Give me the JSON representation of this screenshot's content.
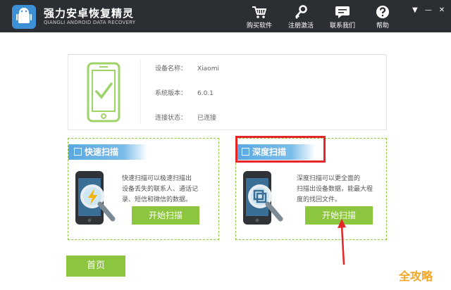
{
  "app": {
    "title": "强力安卓恢复精灵",
    "subtitle": "QIANGLI ANDROID DATA RECOVERY"
  },
  "toolbar": {
    "items": [
      {
        "label": "购买软件",
        "icon": "cart-icon"
      },
      {
        "label": "注册激活",
        "icon": "key-icon"
      },
      {
        "label": "联系我们",
        "icon": "chat-icon"
      },
      {
        "label": "帮助",
        "icon": "help-icon"
      }
    ],
    "window_controls": [
      "▼",
      "—",
      "✕"
    ]
  },
  "device": {
    "name_label": "设备名称：",
    "name_value": "Xiaomi",
    "version_label": "系统版本：",
    "version_value": "6.0.1",
    "status_label": "连接状态：",
    "status_value": "已连接"
  },
  "quick_scan": {
    "title": "快速扫描",
    "description_lines": [
      "快速扫描可以极速扫描出",
      "设备丢失的联系人、通话记",
      "录、短信和微信的数据。"
    ],
    "button_label": "开始扫描"
  },
  "deep_scan": {
    "title": "深度扫描",
    "description_lines": [
      "深度扫描可以更全面的",
      "扫描出设备数据，能最大程",
      "度的找回文件。"
    ],
    "button_label": "开始扫描"
  },
  "home_button_label": "首页",
  "watermark": "全攻略",
  "colors": {
    "titlebar": "#2b2f33",
    "accent_green": "#8cc63e",
    "tab_blue": "#5aa8e2",
    "highlight_red": "#e52629",
    "watermark": "#f5a623"
  }
}
